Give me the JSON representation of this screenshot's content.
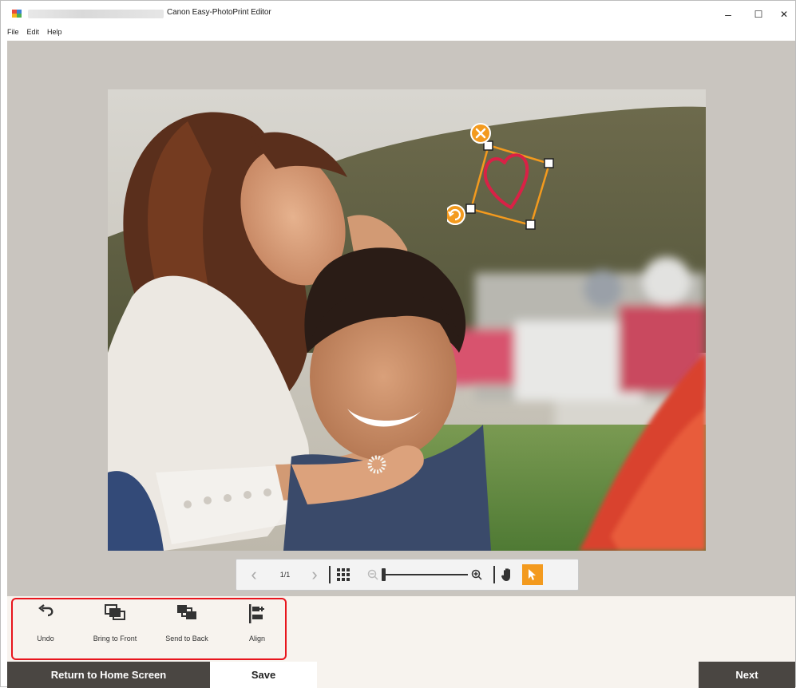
{
  "window": {
    "title": "Canon Easy-PhotoPrint Editor",
    "minimize": "–",
    "maximize": "☐",
    "close": "✕"
  },
  "menu": [
    "File",
    "Edit",
    "Help"
  ],
  "nav": {
    "page_indicator": "1/1",
    "prev": "‹",
    "next": "›"
  },
  "zoom_level_fraction": 0.0,
  "tools": [
    {
      "label": "Undo",
      "icon": "undo-icon"
    },
    {
      "label": "Bring to Front",
      "icon": "bring-to-front-icon"
    },
    {
      "label": "Send to Back",
      "icon": "send-to-back-icon"
    },
    {
      "label": "Align",
      "icon": "align-icon"
    }
  ],
  "footer": {
    "home": "Return to Home Screen",
    "save": "Save",
    "next": "Next"
  },
  "colors": {
    "accent": "#f39a1e",
    "dark_button": "#4a4642",
    "highlight": "#e8151d",
    "heart": "#d92146",
    "panel": "#f7f3ee",
    "canvas": "#c9c5bf"
  }
}
